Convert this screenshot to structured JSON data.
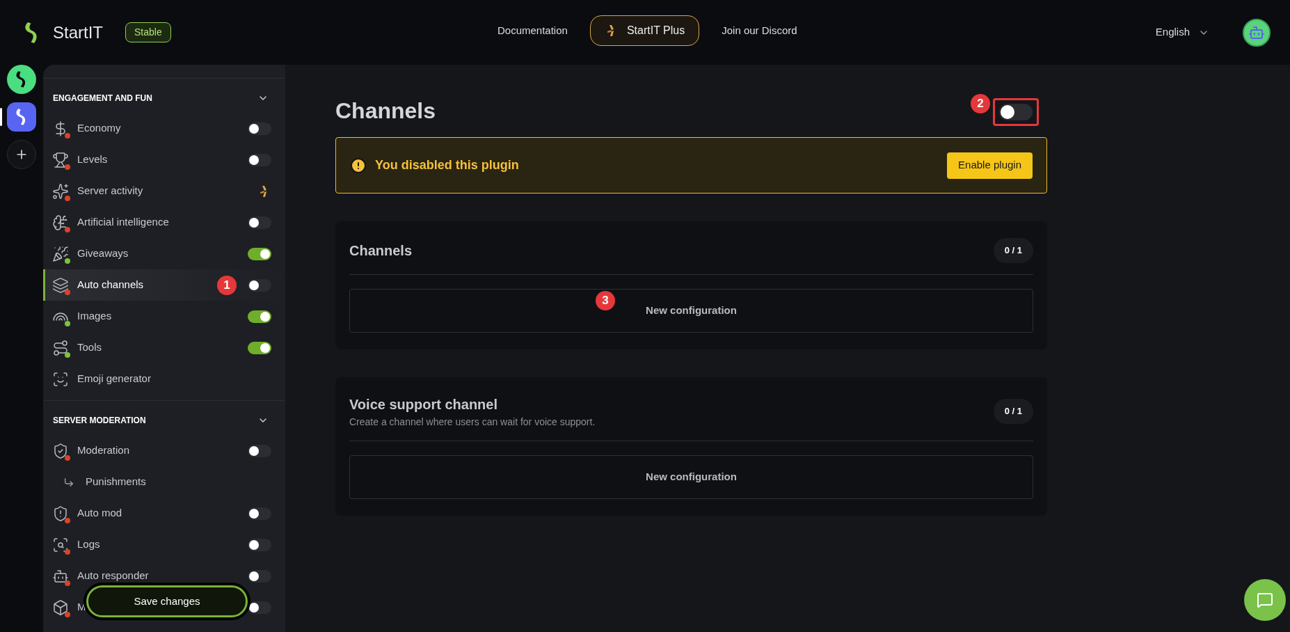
{
  "topbar": {
    "brand": "StartIT",
    "channel_badge": "Stable",
    "nav": [
      {
        "label": "Documentation",
        "kind": "link"
      },
      {
        "label": "StartIT Plus",
        "kind": "premium"
      },
      {
        "label": "Join our Discord",
        "kind": "link"
      }
    ],
    "language": "English"
  },
  "rail": [
    {
      "kind": "server",
      "color": "#4ade80",
      "selected": false
    },
    {
      "kind": "server",
      "color": "#5865f2",
      "selected": true
    },
    {
      "kind": "add"
    }
  ],
  "sidebar": {
    "sections": [
      {
        "title": "ENGAGEMENT AND FUN",
        "expanded": true,
        "items": [
          {
            "label": "Economy",
            "kind": "toggle",
            "on": false,
            "selected": false
          },
          {
            "label": "Levels",
            "kind": "toggle",
            "on": false,
            "selected": false
          },
          {
            "label": "Server activity",
            "kind": "premium",
            "on": false,
            "selected": false
          },
          {
            "label": "Artificial intelligence",
            "kind": "toggle",
            "on": false,
            "selected": false
          },
          {
            "label": "Giveaways",
            "kind": "toggle",
            "on": true,
            "selected": false
          },
          {
            "label": "Auto channels",
            "kind": "toggle",
            "on": false,
            "selected": true
          },
          {
            "label": "Images",
            "kind": "toggle",
            "on": true,
            "selected": false
          },
          {
            "label": "Tools",
            "kind": "toggle",
            "on": true,
            "selected": false
          },
          {
            "label": "Emoji generator",
            "kind": "plain",
            "selected": false
          }
        ]
      },
      {
        "title": "SERVER MODERATION",
        "expanded": true,
        "items": [
          {
            "label": "Moderation",
            "kind": "toggle",
            "on": false,
            "selected": false,
            "children": [
              {
                "label": "Punishments",
                "selected": false
              }
            ]
          },
          {
            "label": "Auto mod",
            "kind": "toggle",
            "on": false,
            "selected": false
          },
          {
            "label": "Logs",
            "kind": "toggle",
            "on": false,
            "selected": false
          },
          {
            "label": "Auto responder",
            "kind": "toggle",
            "on": false,
            "selected": false
          },
          {
            "label": "M",
            "kind": "toggle",
            "on": false,
            "selected": false
          }
        ]
      }
    ]
  },
  "save_button": "Save changes",
  "page": {
    "title": "Channels",
    "plugin_on": false,
    "alert": {
      "message": "You disabled this plugin",
      "action": "Enable plugin"
    },
    "cards": [
      {
        "title": "Channels",
        "count": "0 / 1",
        "button": "New configuration"
      },
      {
        "title": "Voice support channel",
        "description": "Create a channel where users can wait for voice support.",
        "count": "0 / 1",
        "button": "New configuration"
      }
    ]
  },
  "annotations": [
    {
      "label": "1"
    },
    {
      "label": "2"
    },
    {
      "label": "3"
    }
  ]
}
